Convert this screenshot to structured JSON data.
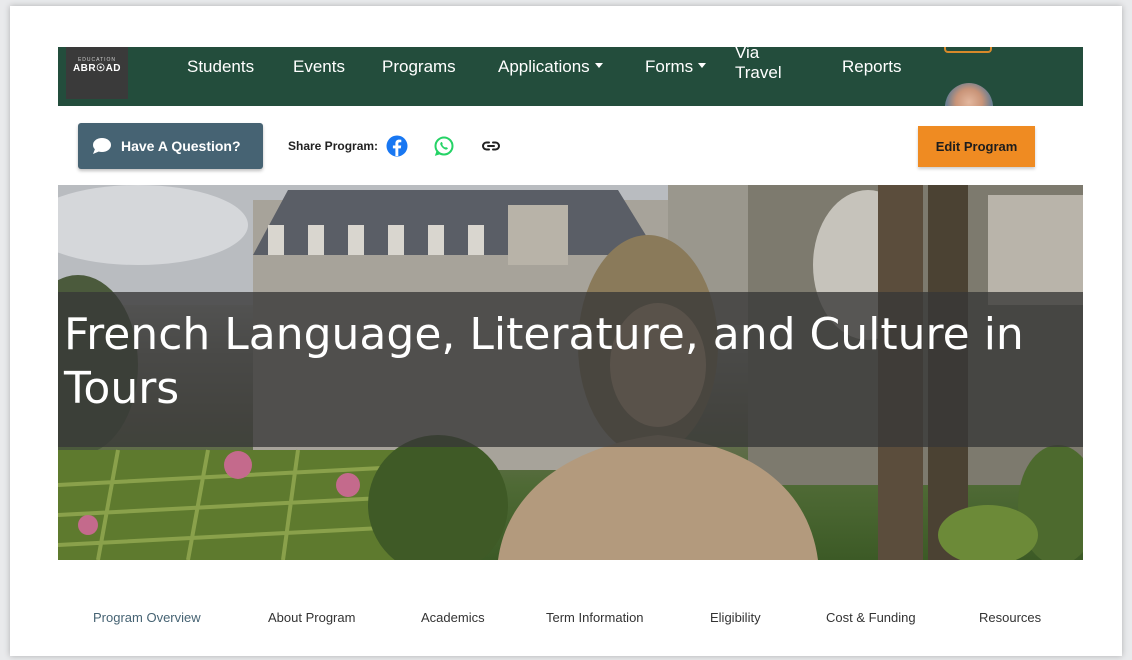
{
  "header": {
    "logo": {
      "top_text": "EDUCATION",
      "main_text": "ABR☉AD"
    },
    "nav": [
      {
        "label": "Students",
        "dropdown": false
      },
      {
        "label": "Events",
        "dropdown": false
      },
      {
        "label": "Programs",
        "dropdown": false
      },
      {
        "label": "Applications",
        "dropdown": true
      },
      {
        "label": "Forms",
        "dropdown": true
      },
      {
        "label": "Via Travel",
        "dropdown": false
      },
      {
        "label": "Reports",
        "dropdown": false
      }
    ]
  },
  "toolbar": {
    "question_label": "Have A Question?",
    "share_label": "Share Program:",
    "share_icons": [
      "facebook-icon",
      "whatsapp-icon",
      "link-icon"
    ],
    "edit_label": "Edit Program"
  },
  "hero": {
    "title": "French Language, Literature, and Culture in Tours"
  },
  "tabs": [
    {
      "label": "Program Overview",
      "active": true
    },
    {
      "label": "About Program",
      "active": false
    },
    {
      "label": "Academics",
      "active": false
    },
    {
      "label": "Term Information",
      "active": false
    },
    {
      "label": "Eligibility",
      "active": false
    },
    {
      "label": "Cost & Funding",
      "active": false
    },
    {
      "label": "Resources",
      "active": false
    }
  ],
  "colors": {
    "navbar": "#234d3c",
    "question_button": "#466373",
    "edit_button": "#ef8b22",
    "facebook": "#1877f2",
    "whatsapp": "#25d366"
  }
}
